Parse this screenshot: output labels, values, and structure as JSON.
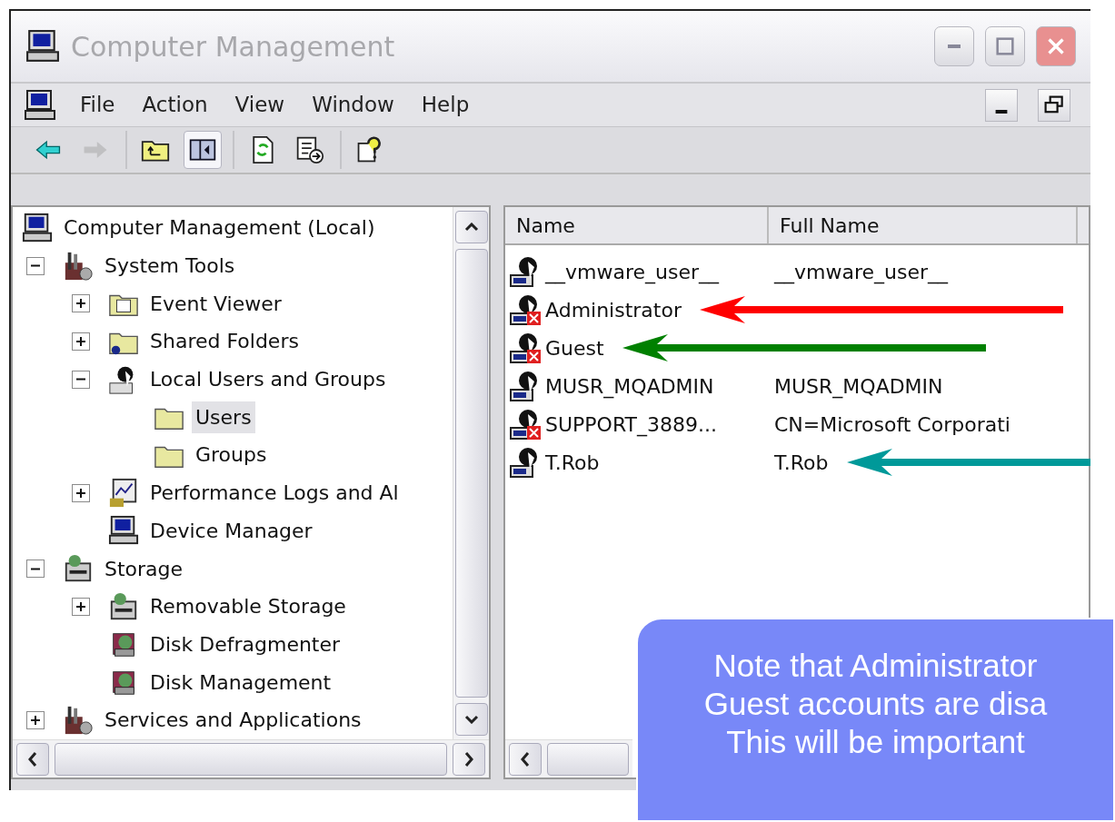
{
  "window": {
    "title": "Computer Management"
  },
  "menu": [
    "File",
    "Action",
    "View",
    "Window",
    "Help"
  ],
  "toolbar": [
    [
      {
        "kind": "back",
        "disabled": false,
        "pressed": false
      },
      {
        "kind": "forward",
        "disabled": true,
        "pressed": false
      }
    ],
    [
      {
        "kind": "up",
        "disabled": false,
        "pressed": false
      },
      {
        "kind": "tree-toggle",
        "disabled": false,
        "pressed": true
      }
    ],
    [
      {
        "kind": "refresh",
        "disabled": false,
        "pressed": false
      },
      {
        "kind": "export",
        "disabled": false,
        "pressed": false
      }
    ],
    [
      {
        "kind": "help",
        "disabled": false,
        "pressed": false
      }
    ]
  ],
  "tree": [
    {
      "label": "Computer Management (Local)",
      "kind": "computer",
      "selected": false,
      "children": [
        {
          "label": "System Tools",
          "kind": "tools",
          "expanded": true,
          "selected": false,
          "children": [
            {
              "label": "Event Viewer",
              "kind": "viewer",
              "expanded": false,
              "selected": false
            },
            {
              "label": "Shared Folders",
              "kind": "shared",
              "expanded": false,
              "selected": false
            },
            {
              "label": "Local Users and Groups",
              "kind": "users",
              "expanded": true,
              "selected": false,
              "children": [
                {
                  "label": "Users",
                  "kind": "folder",
                  "selected": true
                },
                {
                  "label": "Groups",
                  "kind": "folder",
                  "selected": false
                }
              ]
            },
            {
              "label": "Performance Logs and Al",
              "kind": "chart",
              "expanded": false,
              "selected": false
            },
            {
              "label": "Device Manager",
              "kind": "computer",
              "selected": false
            }
          ]
        },
        {
          "label": "Storage",
          "kind": "storage",
          "expanded": true,
          "selected": false,
          "children": [
            {
              "label": "Removable Storage",
              "kind": "storage",
              "expanded": false,
              "selected": false
            },
            {
              "label": "Disk Defragmenter",
              "kind": "disk",
              "selected": false
            },
            {
              "label": "Disk Management",
              "kind": "disk",
              "selected": false
            }
          ]
        },
        {
          "label": "Services and Applications",
          "kind": "tools",
          "expanded": false,
          "selected": false
        }
      ]
    }
  ],
  "list": {
    "columns": [
      "Name",
      "Full Name"
    ],
    "rows": [
      {
        "name": "__vmware_user__",
        "full_name": "__vmware_user__",
        "disabled": false
      },
      {
        "name": "Administrator",
        "disabled": true,
        "arrow": {
          "color": "#ff0000"
        }
      },
      {
        "name": "Guest",
        "disabled": true,
        "arrow": {
          "color": "#008000"
        }
      },
      {
        "name": "MUSR_MQADMIN",
        "full_name": "MUSR_MQADMIN",
        "disabled": false
      },
      {
        "name": "SUPPORT_3889...",
        "full_name": "CN=Microsoft Corporati",
        "disabled": true
      },
      {
        "name": "T.Rob",
        "full_name": "T.Rob",
        "disabled": false,
        "arrow": {
          "color": "#009999"
        }
      }
    ]
  },
  "callout": {
    "lines": [
      "Note that Administrator",
      "Guest accounts are disa",
      "This will be important"
    ]
  }
}
